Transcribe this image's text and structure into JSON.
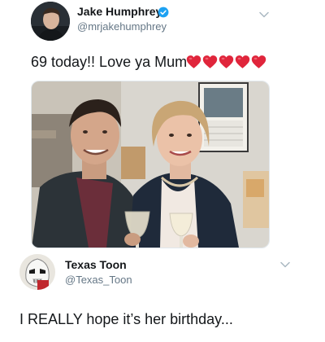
{
  "tweet_original": {
    "author_name": "Jake Humphrey",
    "author_handle": "@mrjakehumphrey",
    "verified": true,
    "text": "69 today!! Love ya Mum",
    "emoji": [
      "red-heart",
      "red-heart",
      "red-heart",
      "red-heart",
      "red-heart"
    ],
    "heart_color": "#e0253b",
    "verified_color": "#1da1f2",
    "has_photo": true
  },
  "tweet_reply": {
    "author_name": "Texas Toon",
    "author_handle": "@Texas_Toon",
    "text": "I REALLY hope it’s her birthday..."
  },
  "icons": {
    "menu": "chevron-down-icon",
    "verified": "verified-badge-icon"
  }
}
